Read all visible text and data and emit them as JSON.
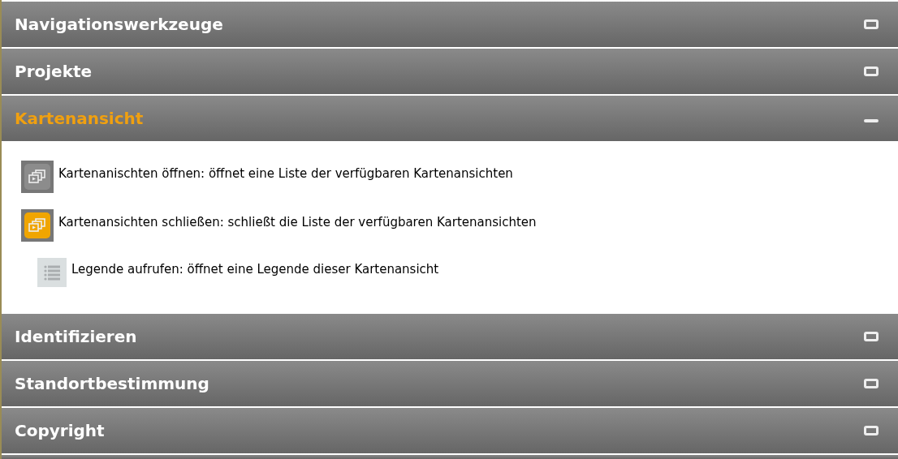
{
  "sections": [
    {
      "title": "Navigationswerkzeuge",
      "expanded": false
    },
    {
      "title": "Projekte",
      "expanded": false
    },
    {
      "title": "Kartenansicht",
      "expanded": true,
      "items": [
        {
          "kind": "open",
          "text": "Kartenanischten öffnen: öffnet eine Liste der verfügbaren Kartenansichten"
        },
        {
          "kind": "close",
          "text": "Kartenansichten schließen: schließt die Liste der verfügbaren Kartenansichten"
        },
        {
          "kind": "legend",
          "text": "Legende aufrufen: öffnet eine Legende dieser Kartenansicht"
        }
      ]
    },
    {
      "title": "Identifizieren",
      "expanded": false
    },
    {
      "title": "Standortbestimmung",
      "expanded": false
    },
    {
      "title": "Copyright",
      "expanded": false
    }
  ]
}
